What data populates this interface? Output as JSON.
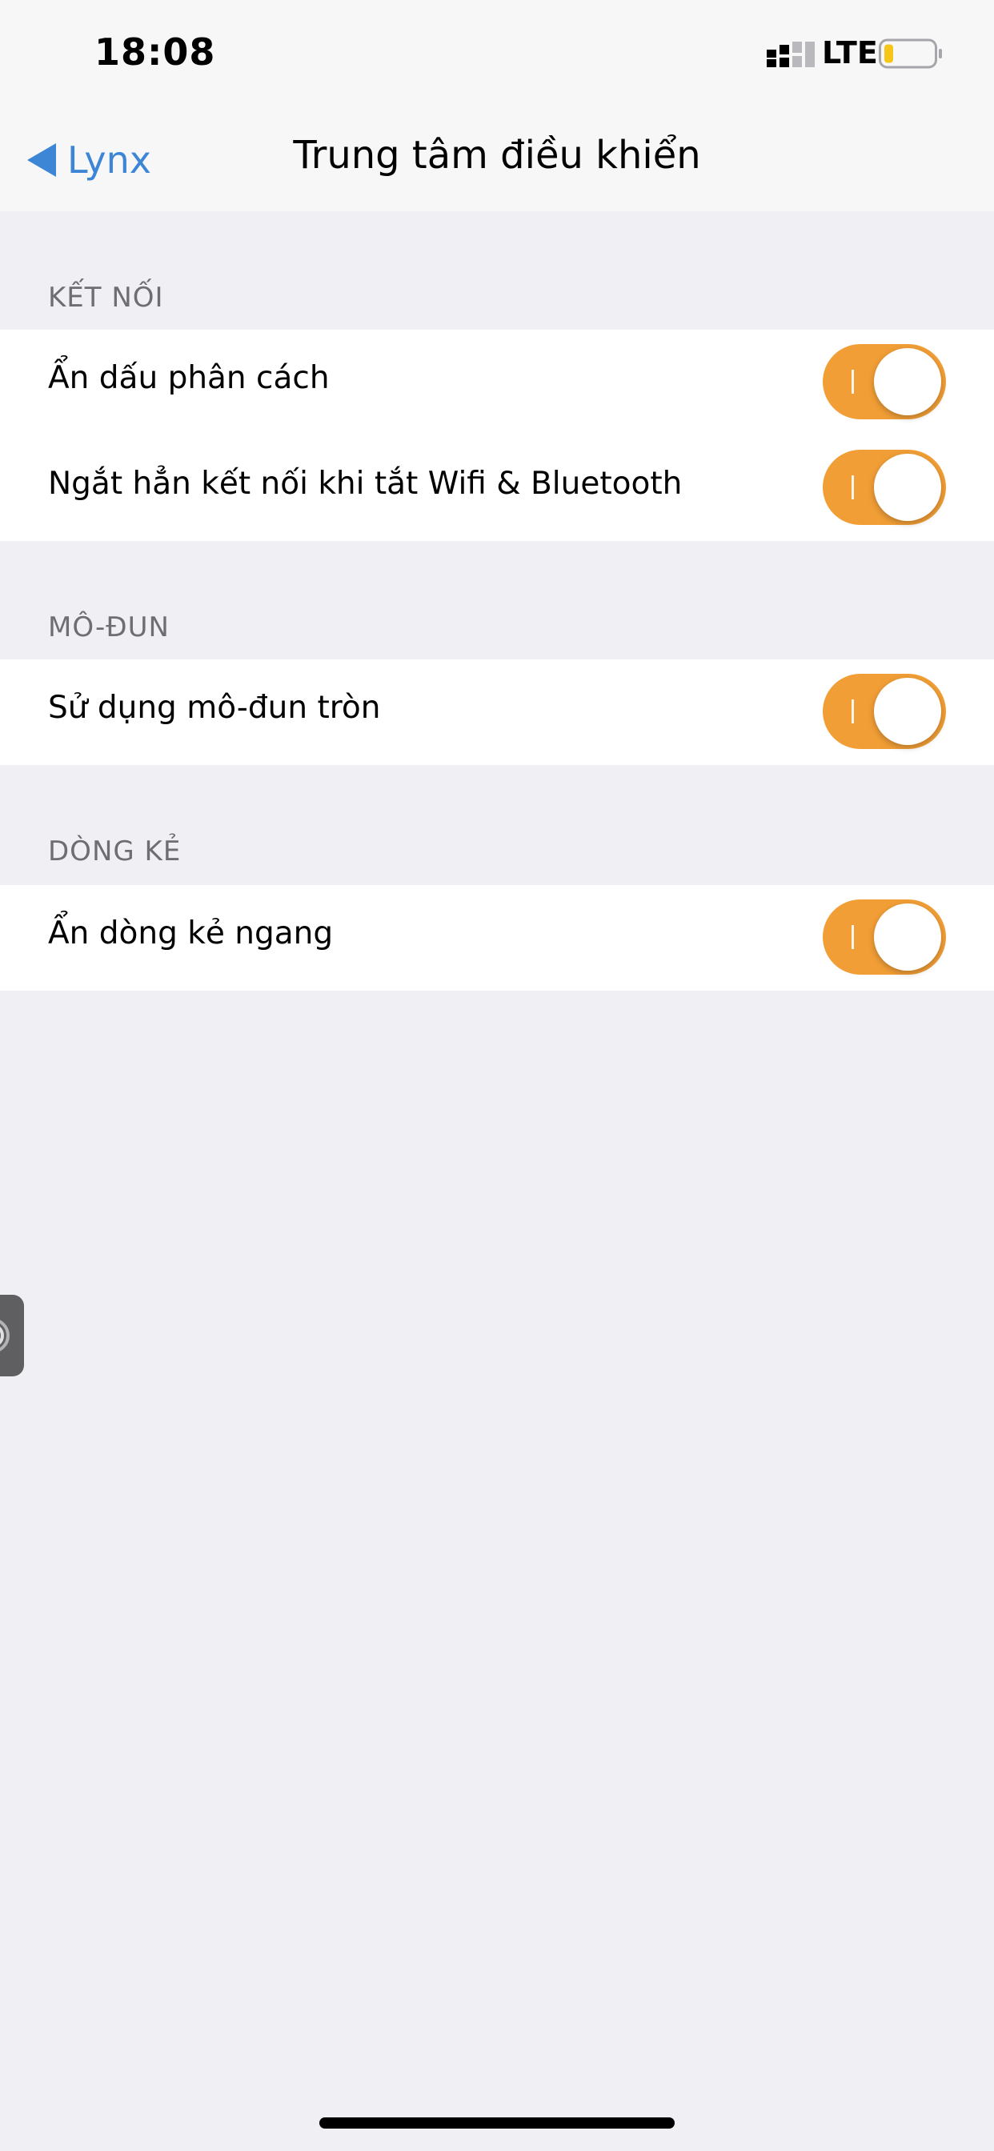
{
  "status_bar": {
    "time": "18:08",
    "network": "LTE",
    "signal_icon": "cellular-signal-icon",
    "battery_icon": "battery-icon",
    "battery_level": 0.15,
    "battery_color": "#f5c518"
  },
  "nav": {
    "back_label": "Lynx",
    "back_icon": "back-triangle-icon",
    "title": "Trung tâm điều khiển",
    "accent_color": "#3d86d5"
  },
  "sections": [
    {
      "header": "KẾT NỐI",
      "rows": [
        {
          "label": "Ẩn dấu phân cách",
          "toggle_on": true
        },
        {
          "label": "Ngắt hẳn kết nối khi tắt Wifi & Bluetooth",
          "toggle_on": true
        }
      ]
    },
    {
      "header": "MÔ-ĐUN",
      "rows": [
        {
          "label": "Sử dụng mô-đun tròn",
          "toggle_on": true
        }
      ]
    },
    {
      "header": "DÒNG KẺ",
      "rows": [
        {
          "label": "Ẩn dòng kẻ ngang",
          "toggle_on": true
        }
      ]
    }
  ],
  "toggle_color": "#f19e36",
  "assistive_touch_icon": "assistive-touch-icon"
}
